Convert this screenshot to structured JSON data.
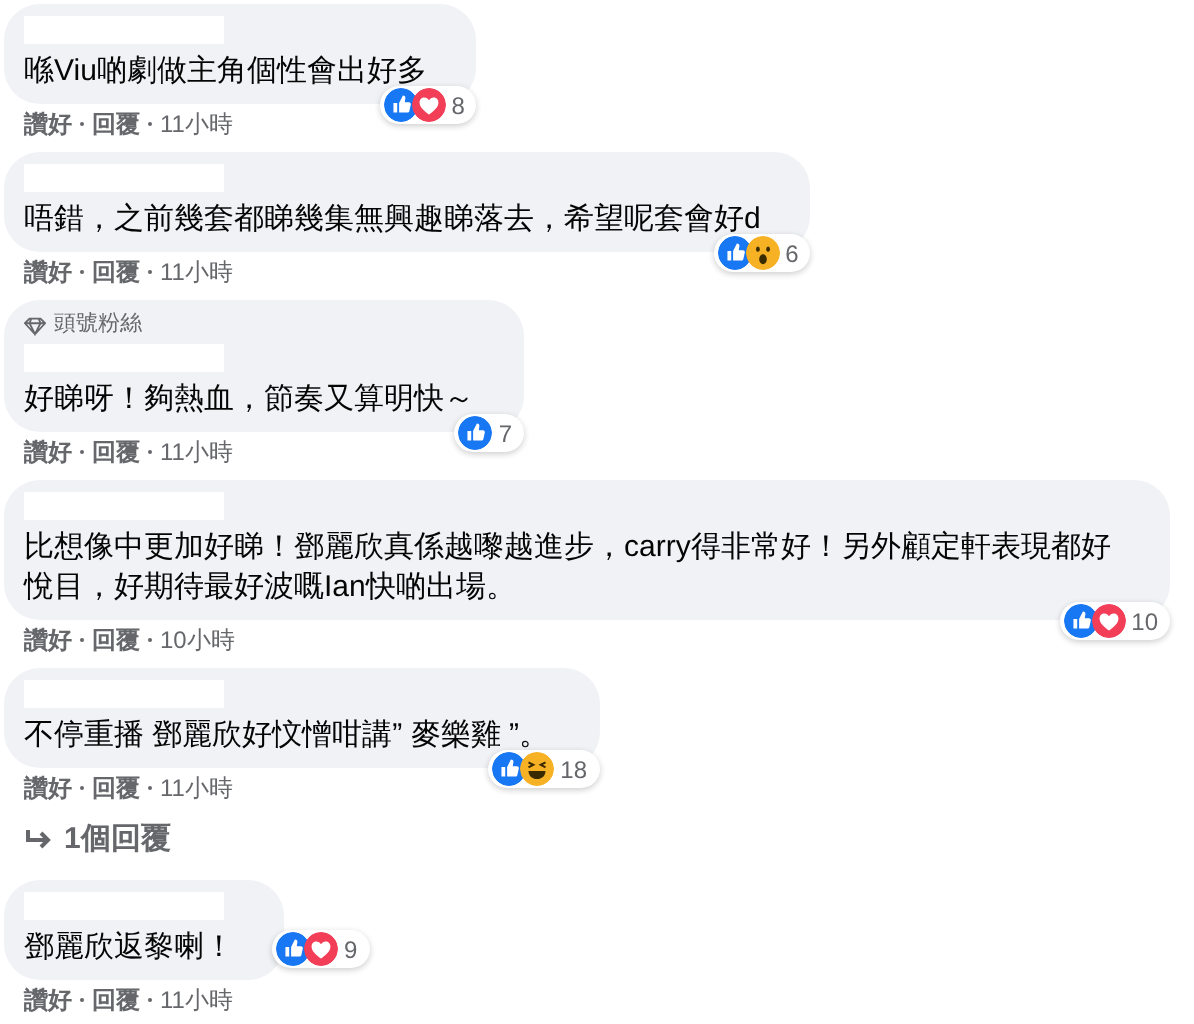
{
  "comments": [
    {
      "text": "喺Viu啲劇做主角個性會出好多",
      "reactions": [
        {
          "kind": "like"
        },
        {
          "kind": "love"
        }
      ],
      "reaction_count": "8",
      "reactions_beside": false,
      "actions": [
        "讚好",
        "回覆",
        "11小時"
      ]
    },
    {
      "text": "唔錯，之前幾套都睇幾集無興趣睇落去，希望呢套會好d",
      "reactions": [
        {
          "kind": "like"
        },
        {
          "kind": "wow"
        }
      ],
      "reaction_count": "6",
      "reactions_beside": false,
      "actions": [
        "讚好",
        "回覆",
        "11小時"
      ]
    },
    {
      "badge": "頭號粉絲",
      "text": "好睇呀！夠熱血，節奏又算明快～",
      "reactions": [
        {
          "kind": "like"
        }
      ],
      "reaction_count": "7",
      "reactions_beside": false,
      "actions": [
        "讚好",
        "回覆",
        "11小時"
      ]
    },
    {
      "text": "比想像中更加好睇！鄧麗欣真係越嚟越進步，carry得非常好！另外顧定軒表現都好悅目，好期待最好波嘅Ian快啲出場。",
      "reactions": [
        {
          "kind": "like"
        },
        {
          "kind": "love"
        }
      ],
      "reaction_count": "10",
      "reactions_beside": false,
      "actions": [
        "讚好",
        "回覆",
        "10小時"
      ]
    },
    {
      "text": "不停重播 鄧麗欣好忟憎咁講” 麥樂雞 ”。",
      "reactions": [
        {
          "kind": "like"
        },
        {
          "kind": "haha"
        }
      ],
      "reaction_count": "18",
      "reactions_beside": false,
      "actions": [
        "讚好",
        "回覆",
        "11小時"
      ],
      "replies_link": "1個回覆"
    },
    {
      "text": "鄧麗欣返黎喇！",
      "reactions": [
        {
          "kind": "like"
        },
        {
          "kind": "love"
        }
      ],
      "reaction_count": "9",
      "reactions_beside": true,
      "actions": [
        "讚好",
        "回覆",
        "11小時"
      ]
    }
  ]
}
